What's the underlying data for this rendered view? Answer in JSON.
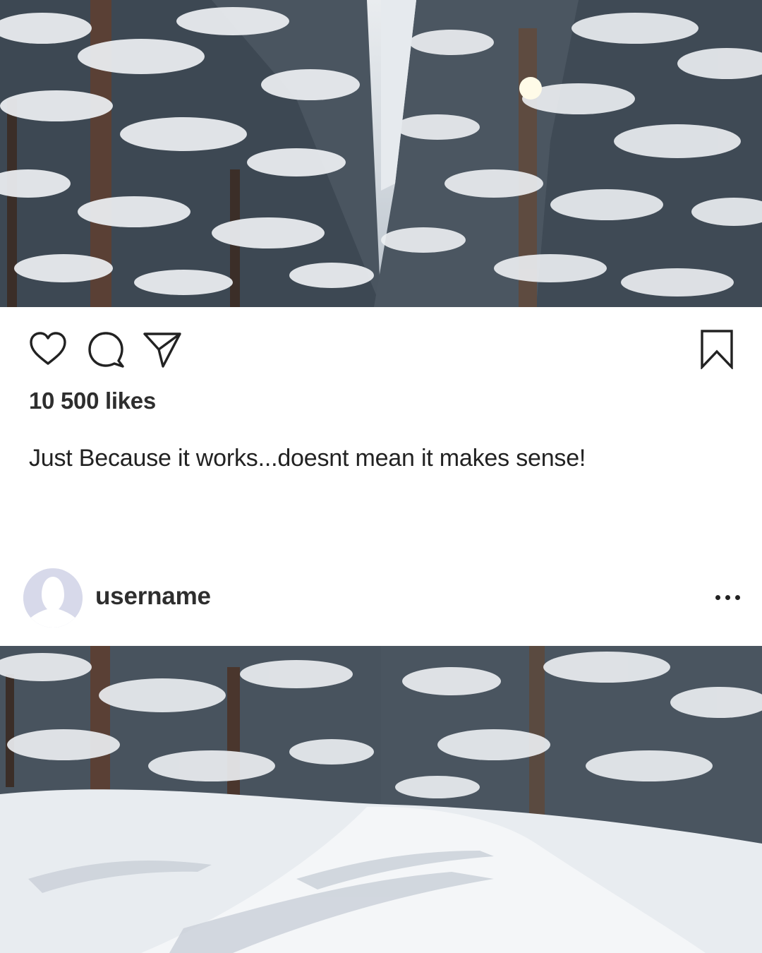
{
  "post": {
    "likes_text": "10 500 likes",
    "caption": "Just Because it works...doesnt mean it makes sense!",
    "username": "username"
  },
  "icons": {
    "like": "heart-icon",
    "comment": "comment-bubble-icon",
    "share": "paper-plane-icon",
    "bookmark": "bookmark-icon",
    "more": "more-options-icon",
    "avatar": "default-avatar-icon"
  },
  "photo": {
    "subject": "snowy-forest-road",
    "colors": {
      "sky": "#e9ecef",
      "tree_dark": "#3a4652",
      "snow": "#eef1f4"
    }
  },
  "colors": {
    "card_background": "#ffffff",
    "text_primary": "#222222",
    "avatar_background": "#d7d9ea"
  }
}
